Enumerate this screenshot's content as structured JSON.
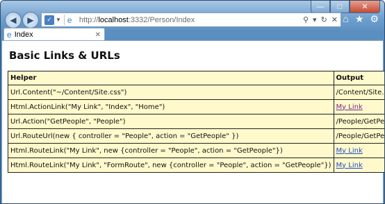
{
  "browser": {
    "address": {
      "prefix": "http://",
      "host": "localhost",
      "rest": ":3332/Person/Index"
    },
    "tab_title": "Index"
  },
  "page": {
    "heading": "Basic Links & URLs",
    "table": {
      "headers": [
        "Helper",
        "Output"
      ],
      "rows": [
        {
          "helper": "Url.Content(\"~/Content/Site.css\")",
          "output": "/Content/Site.css",
          "is_link": false
        },
        {
          "helper": "Html.ActionLink(\"My Link\", \"Index\", \"Home\")",
          "output": "My Link",
          "is_link": true,
          "visited": true
        },
        {
          "helper": "Url.Action(\"GetPeople\", \"People\")",
          "output": "/People/GetPeople",
          "is_link": false
        },
        {
          "helper": "Url.RouteUrl(new { controller = \"People\", action = \"GetPeople\" })",
          "output": "/People/GetPeople",
          "is_link": false
        },
        {
          "helper": "Html.RouteLink(\"My Link\", new {controller = \"People\", action = \"GetPeople\"})",
          "output": "My Link",
          "is_link": true,
          "visited": false
        },
        {
          "helper": "Html.RouteLink(\"My Link\", \"FormRoute\", new {controller = \"People\", action = \"GetPeople\"})",
          "output": "My Link",
          "is_link": true,
          "visited": false
        }
      ]
    }
  },
  "colors": {
    "table_bg": "#fff9cc",
    "link": "#1f4fc4",
    "visited_link": "#7a2a8a"
  }
}
